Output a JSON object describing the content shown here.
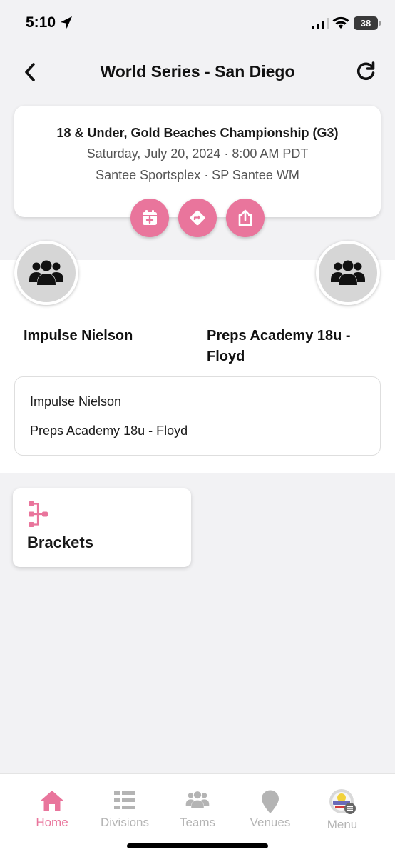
{
  "status_bar": {
    "time": "5:10",
    "battery": "38"
  },
  "header": {
    "title": "World Series - San Diego",
    "back_icon": "chevron-left-icon",
    "refresh_icon": "refresh-icon"
  },
  "game": {
    "division": "18 & Under, Gold Beaches Championship (G3)",
    "datetime": "Saturday, July 20, 2024 · 8:00 AM PDT",
    "venue": "Santee Sportsplex · SP Santee WM",
    "actions": [
      {
        "icon": "calendar-add-icon"
      },
      {
        "icon": "directions-icon"
      },
      {
        "icon": "share-icon"
      }
    ]
  },
  "teams": {
    "home": {
      "name": "Impulse Nielson",
      "icon": "team-group-icon"
    },
    "away": {
      "name_line1": "Preps Academy 18u -",
      "name_line2": "Floyd",
      "icon": "team-group-icon"
    },
    "score_lines": [
      "Impulse Nielson",
      "Preps Academy 18u - Floyd"
    ]
  },
  "brackets": {
    "label": "Brackets",
    "icon": "bracket-tree-icon"
  },
  "tabs": [
    {
      "label": "Home",
      "icon": "home-icon",
      "active": true
    },
    {
      "label": "Divisions",
      "icon": "list-icon",
      "active": false
    },
    {
      "label": "Teams",
      "icon": "team-group-icon",
      "active": false
    },
    {
      "label": "Venues",
      "icon": "map-pin-icon",
      "active": false
    },
    {
      "label": "Menu",
      "icon": "event-logo-icon",
      "active": false
    }
  ],
  "colors": {
    "accent": "#e9759c",
    "inactive": "#b4b4b4",
    "background": "#f2f2f4"
  }
}
